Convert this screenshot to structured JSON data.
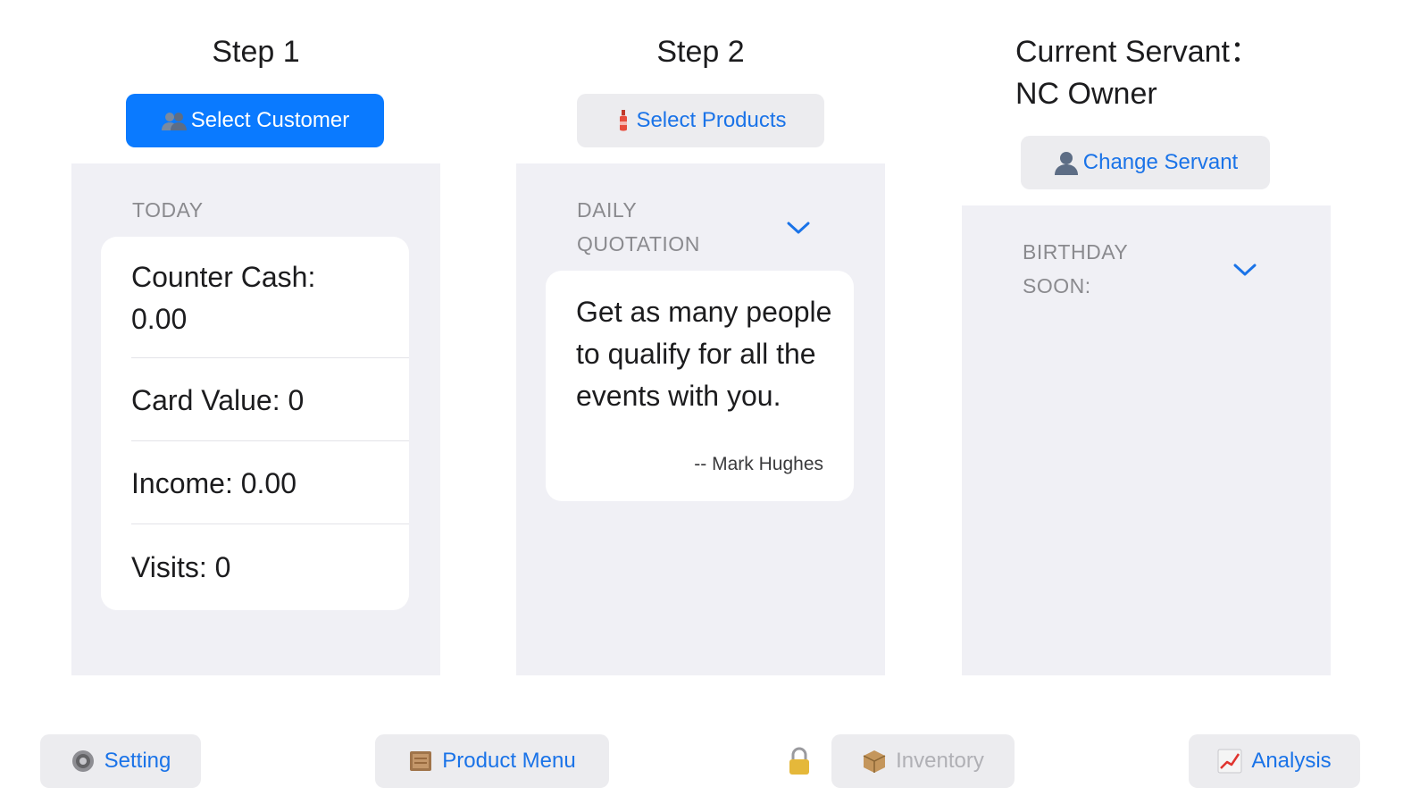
{
  "step1": {
    "title": "Step 1",
    "button_label": "Select Customer",
    "section_label": "TODAY",
    "rows": [
      "Counter Cash: 0.00",
      "Card Value: 0",
      "Income: 0.00",
      "Visits: 0"
    ]
  },
  "step2": {
    "title": "Step 2",
    "button_label": "Select Products",
    "section_label": "DAILY QUOTATION",
    "quote": "Get as many people to qualify for all the events with you.",
    "author": "-- Mark Hughes"
  },
  "servant": {
    "title": "Current Servant：NC Owner",
    "button_label": "Change Servant",
    "section_label": "BIRTHDAY SOON:"
  },
  "bottom": {
    "setting": "Setting",
    "product_menu": "Product Menu",
    "inventory": "Inventory",
    "analysis": "Analysis"
  },
  "colors": {
    "accent": "#0a7aff",
    "link": "#1a73e8",
    "panel_bg": "#f0f0f5",
    "button_bg": "#ececef"
  }
}
